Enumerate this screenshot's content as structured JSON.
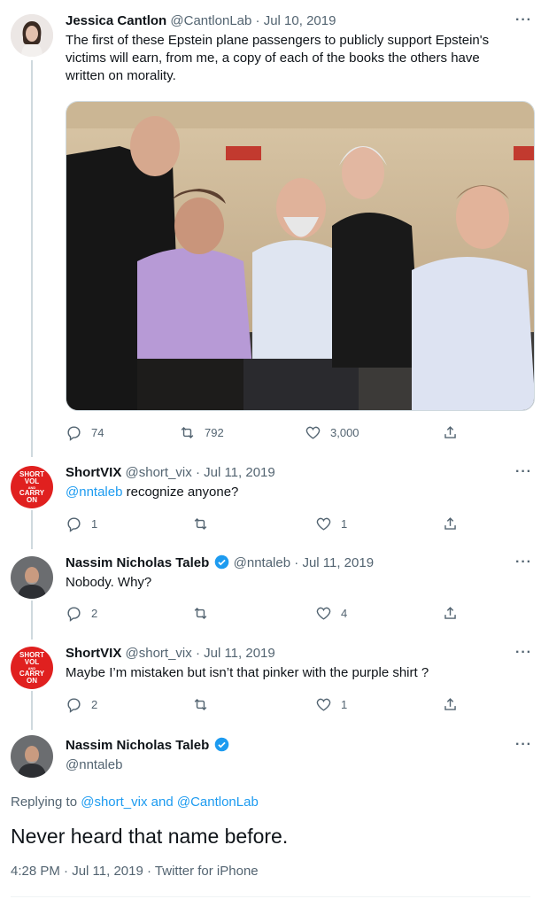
{
  "tweets": [
    {
      "name": "Jessica Cantlon",
      "handle": "@CantlonLab",
      "date": "Jul 10, 2019",
      "text": "The first of these Epstein plane passengers to publicly support Epstein's victims will earn, from me, a copy of each of the books the others have written on morality.",
      "replies": "74",
      "retweets": "792",
      "likes": "3,000"
    },
    {
      "name": "ShortVIX",
      "handle": "@short_vix",
      "date": "Jul 11, 2019",
      "mention": "@nntaleb",
      "text": " recognize anyone?",
      "replies": "1",
      "retweets": "",
      "likes": "1"
    },
    {
      "name": "Nassim Nicholas Taleb",
      "handle": "@nntaleb",
      "date": "Jul 11, 2019",
      "text": "Nobody. Why?",
      "replies": "2",
      "retweets": "",
      "likes": "4"
    },
    {
      "name": "ShortVIX",
      "handle": "@short_vix",
      "date": "Jul 11, 2019",
      "text": "Maybe I’m mistaken but isn’t that pinker with the purple shirt ?",
      "replies": "2",
      "retweets": "",
      "likes": "1"
    }
  ],
  "svix_avatar": {
    "line1": "SHORT",
    "line2": "VOL",
    "line3": "AND",
    "line4": "CARRY",
    "line5": "ON"
  },
  "main": {
    "name": "Nassim Nicholas Taleb",
    "handle": "@nntaleb",
    "replying_prefix": "Replying to ",
    "replying_to_1": "@short_vix",
    "replying_and": " and ",
    "replying_to_2": "@CantlonLab",
    "text": "Never heard that name before.",
    "time": "4:28 PM",
    "date": "Jul 11, 2019",
    "source": "Twitter for iPhone"
  },
  "ui": {
    "more": "···",
    "separator": "·"
  },
  "colors": {
    "accent": "#1d9bf0",
    "secondary_text": "#536471",
    "thread_line": "#cfd9de",
    "svix_red": "#e0201f"
  },
  "icons": [
    "reply-icon",
    "retweet-icon",
    "like-icon",
    "share-icon",
    "verified-badge-icon",
    "more-icon"
  ]
}
